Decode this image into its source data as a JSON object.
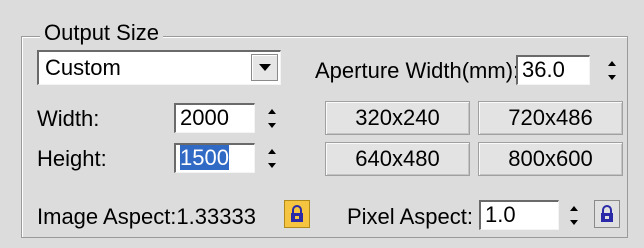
{
  "group": {
    "title": "Output Size"
  },
  "preset_combo": {
    "value": "Custom"
  },
  "aperture": {
    "label": "Aperture Width(mm):",
    "value": "36.0"
  },
  "width": {
    "label": "Width:",
    "value": "2000"
  },
  "height": {
    "label": "Height:",
    "value": "1500"
  },
  "presets": [
    "320x240",
    "720x486",
    "640x480",
    "800x600"
  ],
  "image_aspect": {
    "label": "Image Aspect:",
    "value": "1.33333",
    "locked": true
  },
  "pixel_aspect": {
    "label": "Pixel Aspect:",
    "value": "1.0",
    "locked": false
  },
  "colors": {
    "background": "#dcdcdc",
    "selection": "#316ac5",
    "lock_active": "#f5c440",
    "lock_icon": "#2a2aa8"
  }
}
